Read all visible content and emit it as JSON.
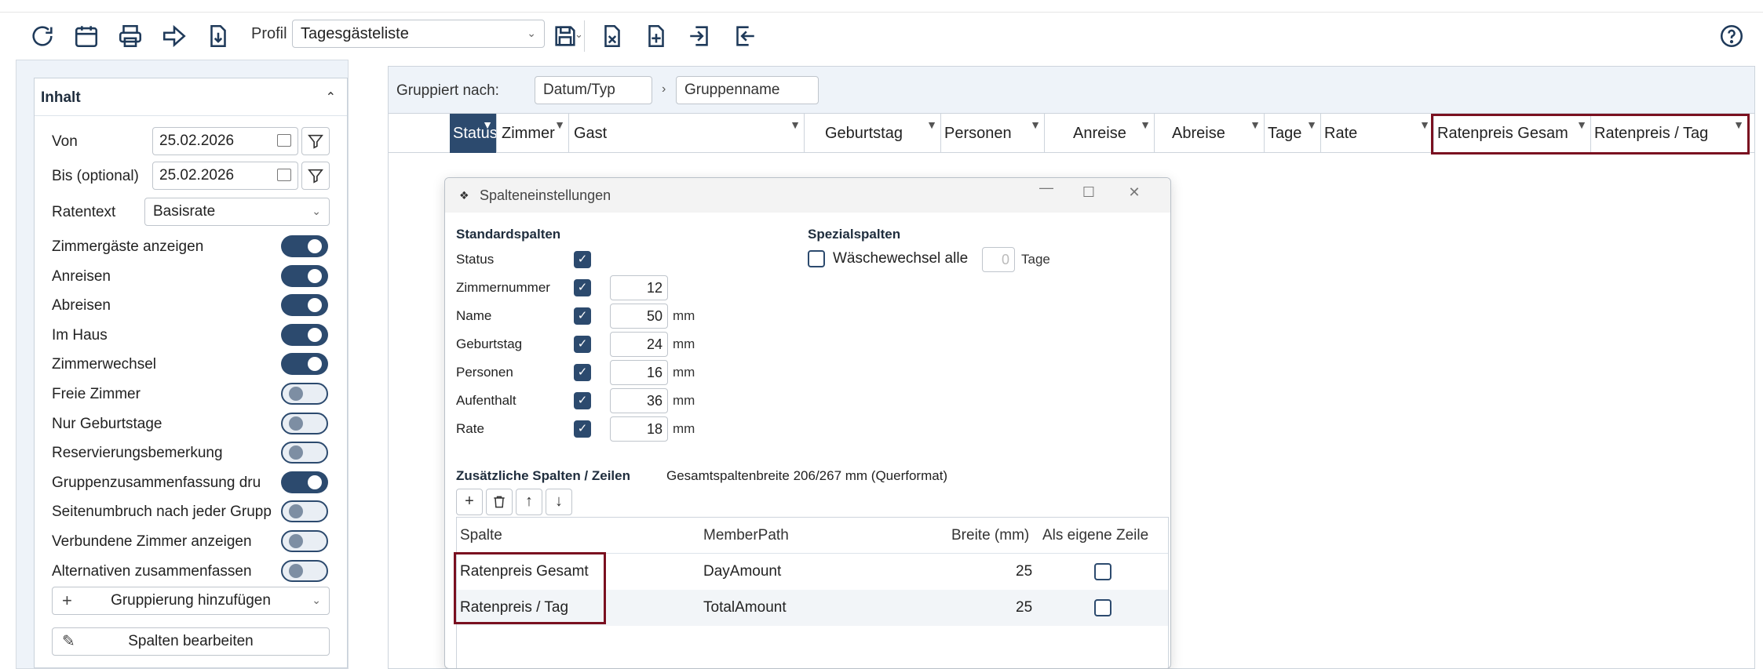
{
  "toolbar": {
    "profil_label": "Profil",
    "profil_value": "Tagesgästeliste"
  },
  "inhalt": {
    "title": "Inhalt",
    "von_label": "Von",
    "von_value": "25.02.2026",
    "bis_label": "Bis (optional)",
    "bis_value": "25.02.2026",
    "ratentext_label": "Ratentext",
    "ratentext_value": "Basisrate",
    "toggles": [
      {
        "label": "Zimmergäste anzeigen",
        "on": true
      },
      {
        "label": "Anreisen",
        "on": true
      },
      {
        "label": "Abreisen",
        "on": true
      },
      {
        "label": "Im Haus",
        "on": true
      },
      {
        "label": "Zimmerwechsel",
        "on": true
      },
      {
        "label": "Freie Zimmer",
        "on": false
      },
      {
        "label": "Nur Geburtstage",
        "on": false
      },
      {
        "label": "Reservierungsbemerkung",
        "on": false
      },
      {
        "label": "Gruppenzusammenfassung dru",
        "on": true
      },
      {
        "label": "Seitenumbruch nach jeder Grupp",
        "on": false
      },
      {
        "label": "Verbundene Zimmer anzeigen",
        "on": false
      },
      {
        "label": "Alternativen zusammenfassen",
        "on": false
      }
    ],
    "add_grouping": "Gruppierung hinzufügen",
    "edit_columns": "Spalten bearbeiten"
  },
  "grouping": {
    "label": "Gruppiert nach:",
    "chip1": "Datum/Typ",
    "chip2": "Gruppenname"
  },
  "grid": {
    "columns": [
      "Status",
      "Zimmer",
      "Gast",
      "Geburtstag",
      "Personen",
      "Anreise",
      "Abreise",
      "Tage",
      "Rate",
      "Ratenpreis Gesam",
      "Ratenpreis / Tag"
    ]
  },
  "dialog": {
    "title": "Spalteneinstellungen",
    "standard_title": "Standardspalten",
    "special_title": "Spezialspalten",
    "waesche_label": "Wäschewechsel alle",
    "waesche_value": "0",
    "waesche_unit": "Tage",
    "rows": [
      {
        "label": "Status",
        "value": null,
        "unit": ""
      },
      {
        "label": "Zimmernummer",
        "value": "12",
        "unit": ""
      },
      {
        "label": "Name",
        "value": "50",
        "unit": "mm"
      },
      {
        "label": "Geburtstag",
        "value": "24",
        "unit": "mm"
      },
      {
        "label": "Personen",
        "value": "16",
        "unit": "mm"
      },
      {
        "label": "Aufenthalt",
        "value": "36",
        "unit": "mm"
      },
      {
        "label": "Rate",
        "value": "18",
        "unit": "mm"
      }
    ],
    "extra_title": "Zusätzliche Spalten / Zeilen",
    "total_width": "Gesamtspaltenbreite 206/267 mm (Querformat)",
    "table": {
      "headers": [
        "Spalte",
        "MemberPath",
        "Breite (mm)",
        "Als eigene Zeile"
      ],
      "rows": [
        {
          "spalte": "Ratenpreis Gesamt",
          "member": "DayAmount",
          "breite": "25"
        },
        {
          "spalte": "Ratenpreis / Tag",
          "member": "TotalAmount",
          "breite": "25"
        }
      ]
    }
  }
}
